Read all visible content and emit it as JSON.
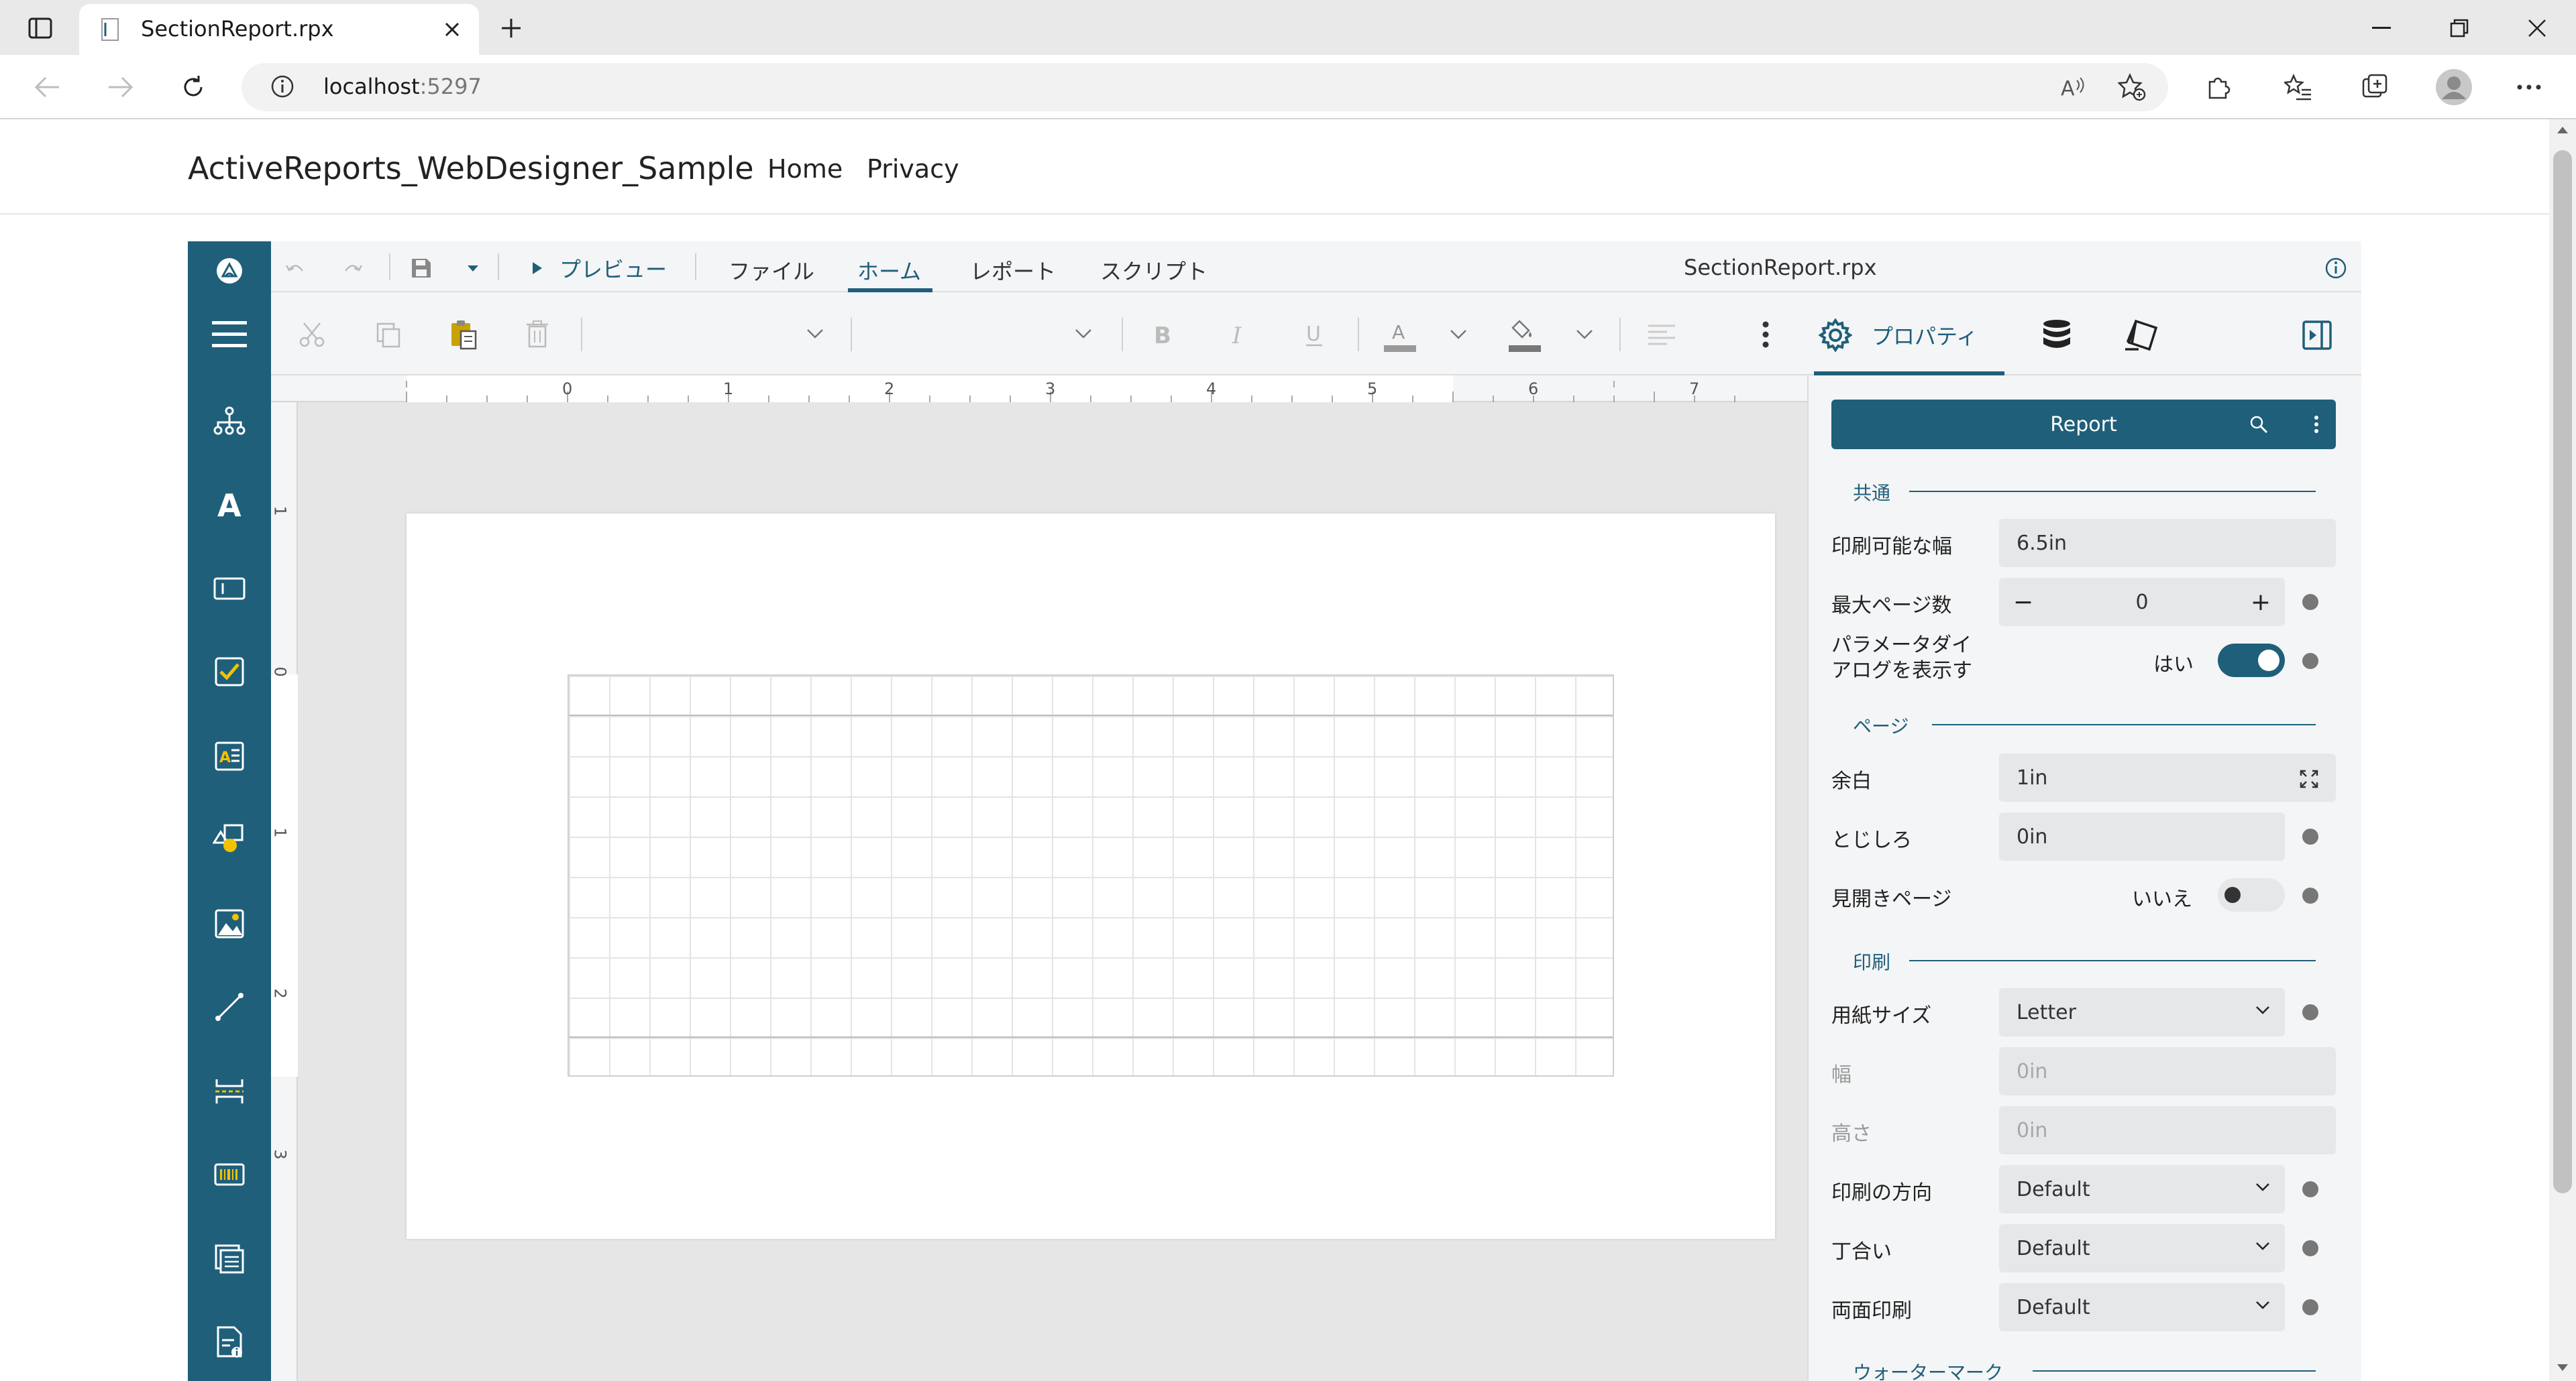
{
  "browser": {
    "tab_title": "SectionReport.rpx",
    "new_tab_label": "+",
    "url_host": "localhost",
    "url_port": ":5297"
  },
  "site": {
    "brand": "ActiveReports_WebDesigner_Sample",
    "nav": [
      {
        "label": "Home"
      },
      {
        "label": "Privacy"
      }
    ]
  },
  "designer": {
    "menu": {
      "preview_label": "プレビュー",
      "file_label": "ファイル",
      "home_label": "ホーム",
      "report_label": "レポート",
      "script_label": "スクリプト"
    },
    "document_title": "SectionReport.rpx",
    "ruler": {
      "h_labels": [
        "0",
        "1",
        "2",
        "3",
        "4",
        "5",
        "6",
        "7"
      ],
      "v_labels": [
        "1",
        "0",
        "1",
        "2",
        "3"
      ]
    },
    "props_tab_label": "プロパティ"
  },
  "properties": {
    "object_name": "Report",
    "sections": {
      "common": "共通",
      "page": "ページ",
      "print": "印刷",
      "watermark": "ウォーターマーク"
    },
    "rows": {
      "printable_width": {
        "label": "印刷可能な幅",
        "value": "6.5in"
      },
      "max_pages": {
        "label": "最大ページ数",
        "value": "0",
        "minus": "−",
        "plus": "+"
      },
      "show_param_dialog": {
        "label_line1": "パラメータダイ",
        "label_line2": "アログを表示す",
        "value": "はい",
        "on": true
      },
      "margins": {
        "label": "余白",
        "value": "1in"
      },
      "gutter": {
        "label": "とじしろ",
        "value": "0in"
      },
      "mirror_margins": {
        "label": "見開きページ",
        "value": "いいえ",
        "on": false
      },
      "paper_size": {
        "label": "用紙サイズ",
        "value": "Letter"
      },
      "width": {
        "label": "幅",
        "value": "0in"
      },
      "height": {
        "label": "高さ",
        "value": "0in"
      },
      "orientation": {
        "label": "印刷の方向",
        "value": "Default"
      },
      "collate": {
        "label": "丁合い",
        "value": "Default"
      },
      "duplex": {
        "label": "両面印刷",
        "value": "Default"
      }
    }
  },
  "colors": {
    "accent": "#1f5f7a",
    "checkbox_icon": "#f2c200"
  }
}
